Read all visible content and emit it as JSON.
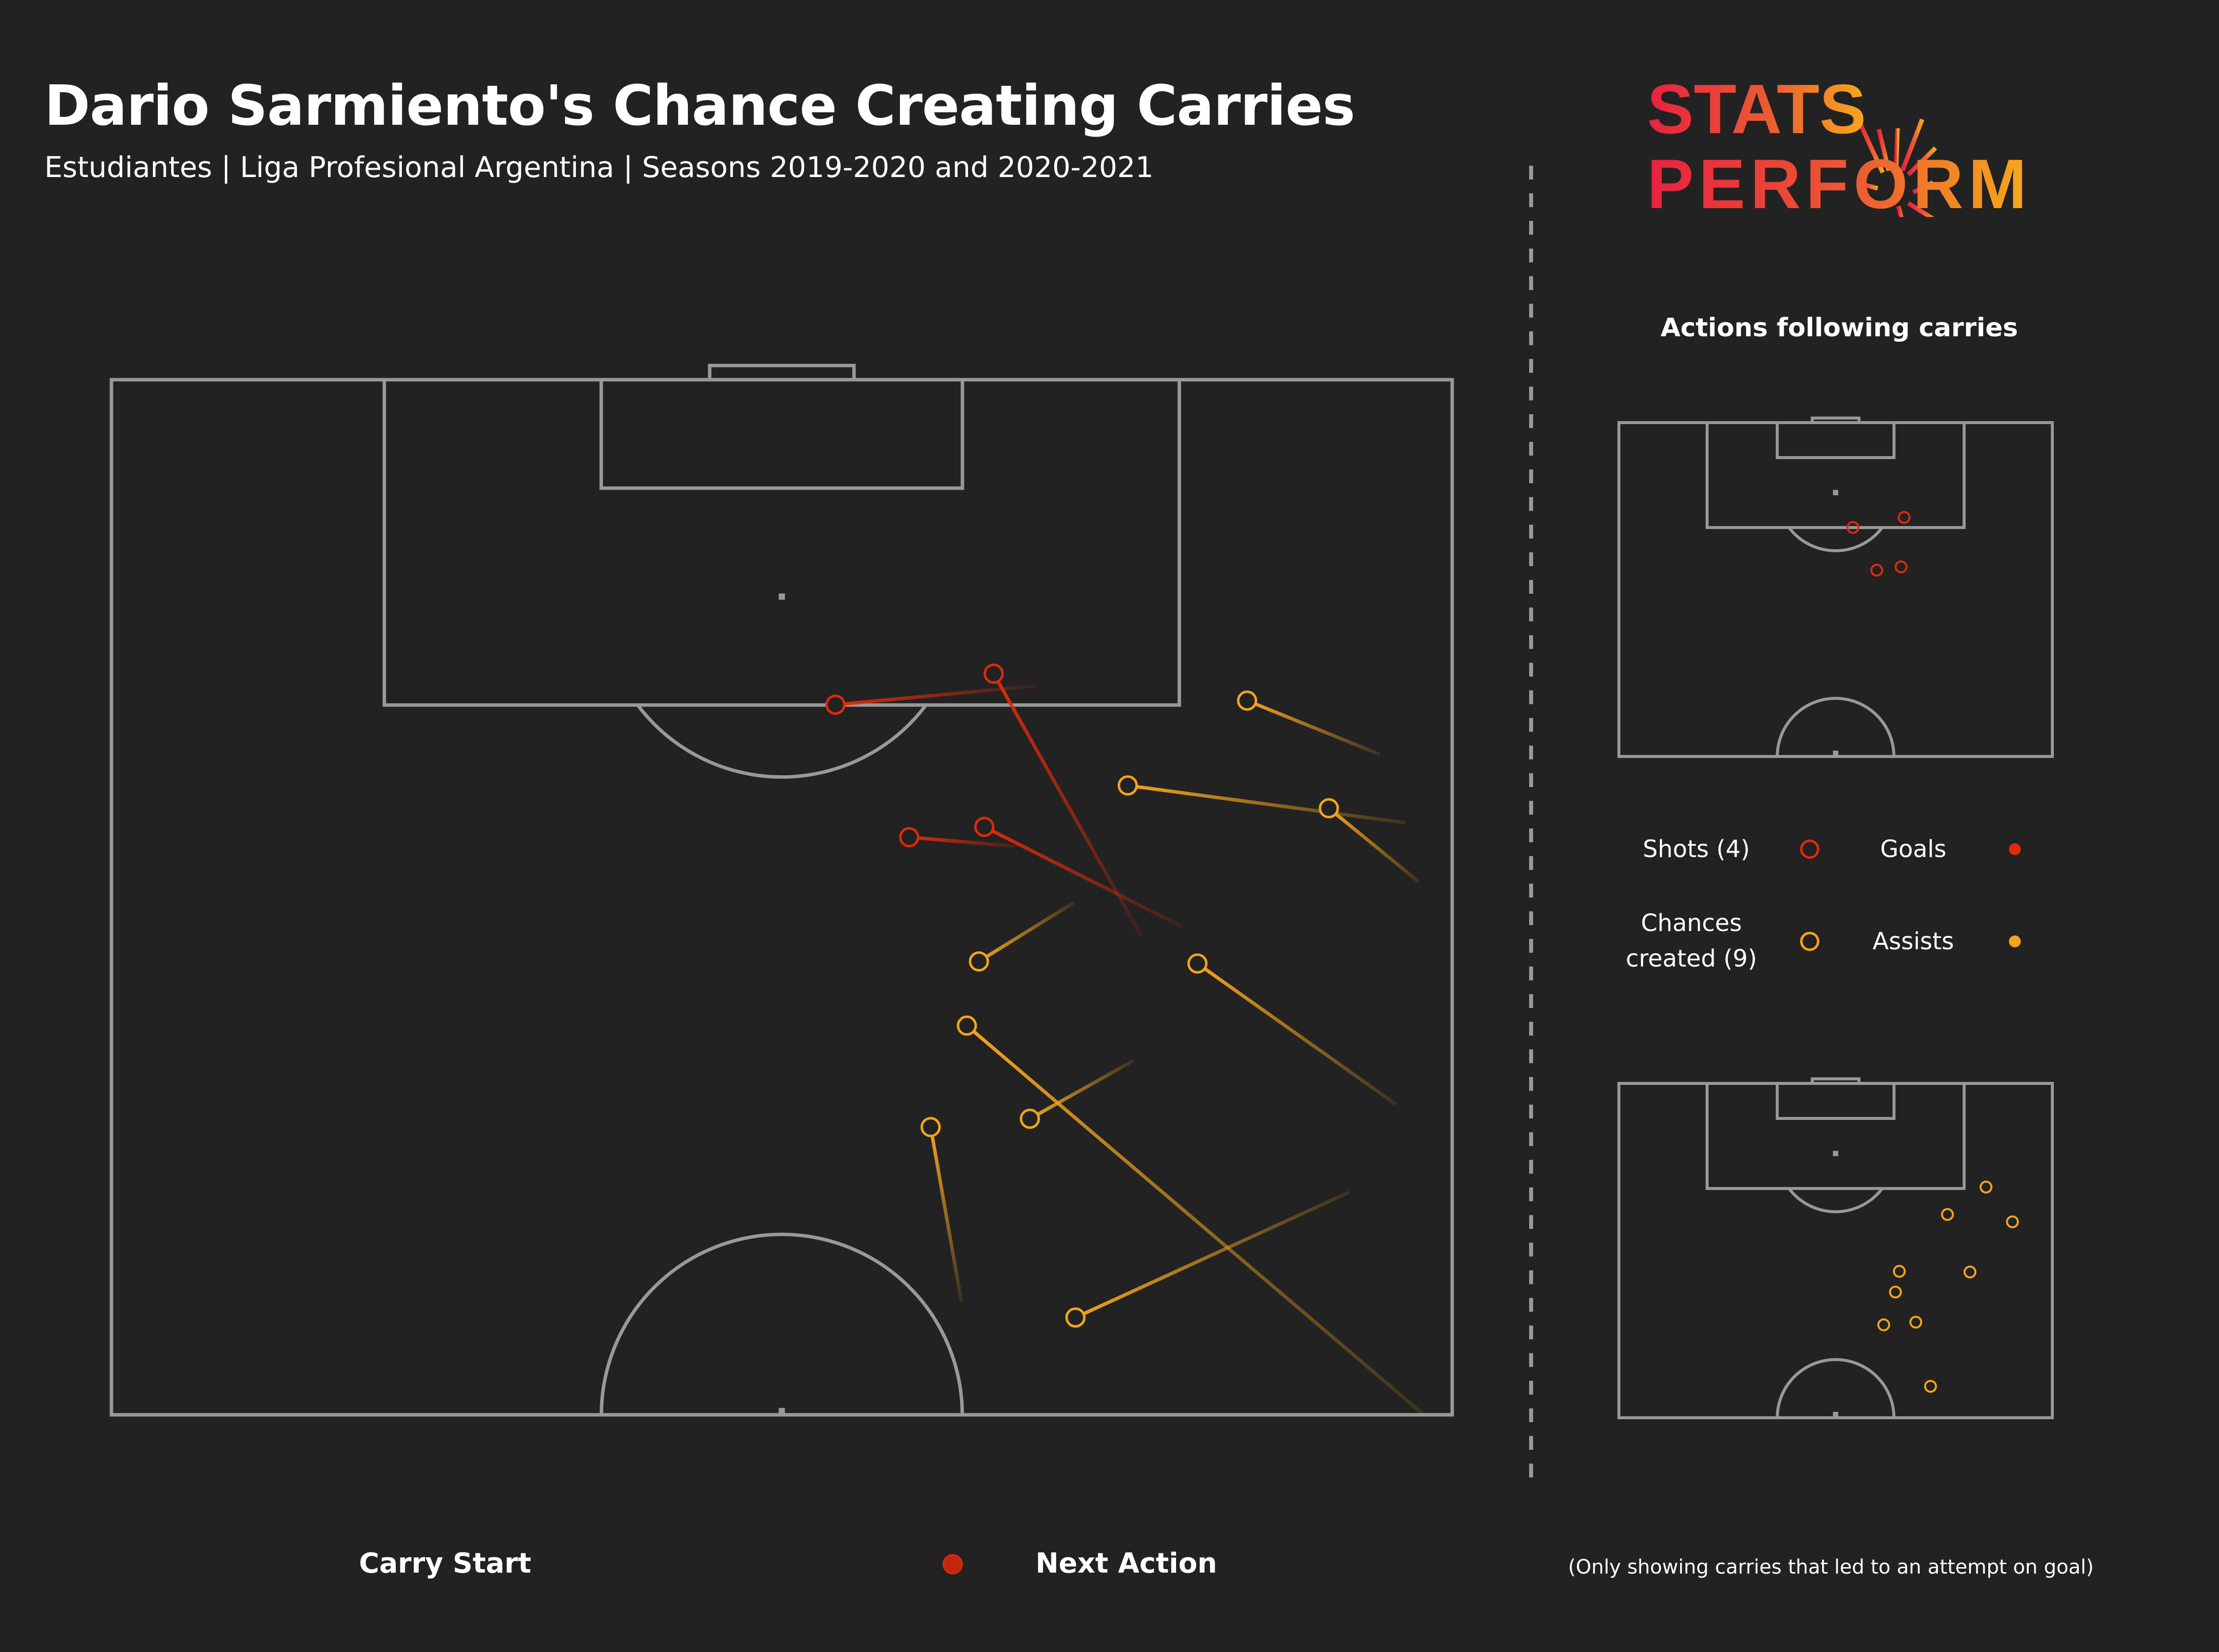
{
  "header": {
    "title": "Dario Sarmiento's Chance Creating Carries",
    "subtitle": "Estudiantes | Liga Profesional Argentina | Seasons 2019-2020 and 2020-2021"
  },
  "logo": {
    "line1": "STATS",
    "line2": "PERFORM",
    "gradient_start": "#E8213F",
    "gradient_end": "#F6A81C"
  },
  "side_panel": {
    "title": "Actions following carries"
  },
  "legend": {
    "shots_label": "Shots (4)",
    "goals_label": "Goals",
    "chances_label_line1": "Chances",
    "chances_label_line2": "created (9)",
    "assists_label": "Assists"
  },
  "carry_legend": {
    "start_label": "Carry Start",
    "end_label": "Next Action"
  },
  "footnote": "(Only showing carries that led to an attempt on goal)",
  "colors": {
    "background": "#222222",
    "pitch_lines": "#999999",
    "shot": "#E02A0A",
    "chance": "#F3A41D"
  },
  "chart_data": {
    "type": "scatter",
    "title": "Dario Sarmiento's Chance Creating Carries",
    "description": "Carries drawn on attacking half of pitch. x = % across pitch width (0 = left touchline, 100 = right touchline); y = % of half-pitch length from opponent goal line (0 = goal line, 100 = halfway line). Each carry fades from its start and ends in a circle at the next action.",
    "axes": {
      "x_range": [
        0,
        100
      ],
      "y_range": [
        0,
        100
      ],
      "grid": false
    },
    "series": [
      {
        "name": "Shots (4)",
        "color": "#E02A0A",
        "carries": [
          {
            "start": [
              68.8,
              29.6
            ],
            "end": [
              54.0,
              31.4
            ]
          },
          {
            "start": [
              76.8,
              53.7
            ],
            "end": [
              65.8,
              28.4
            ]
          },
          {
            "start": [
              67.7,
              45.1
            ],
            "end": [
              59.5,
              44.2
            ]
          },
          {
            "start": [
              79.8,
              52.8
            ],
            "end": [
              65.1,
              43.2
            ]
          }
        ]
      },
      {
        "name": "Chances created (9)",
        "color": "#F3A41D",
        "carries": [
          {
            "start": [
              94.6,
              36.2
            ],
            "end": [
              84.7,
              31.0
            ]
          },
          {
            "start": [
              96.5,
              42.8
            ],
            "end": [
              75.8,
              39.2
            ]
          },
          {
            "start": [
              97.5,
              48.5
            ],
            "end": [
              90.8,
              41.4
            ]
          },
          {
            "start": [
              71.8,
              50.5
            ],
            "end": [
              64.7,
              56.2
            ]
          },
          {
            "start": [
              95.8,
              70.0
            ],
            "end": [
              81.0,
              56.4
            ]
          },
          {
            "start": [
              97.8,
              99.9
            ],
            "end": [
              63.8,
              62.4
            ]
          },
          {
            "start": [
              76.2,
              65.8
            ],
            "end": [
              68.5,
              71.4
            ]
          },
          {
            "start": [
              63.4,
              89.1
            ],
            "end": [
              61.1,
              72.2
            ]
          },
          {
            "start": [
              92.3,
              78.5
            ],
            "end": [
              71.9,
              90.6
            ]
          }
        ]
      }
    ],
    "goals": 0,
    "assists": 0,
    "legend": [
      "Shots (4)",
      "Goals",
      "Chances created (9)",
      "Assists"
    ]
  }
}
